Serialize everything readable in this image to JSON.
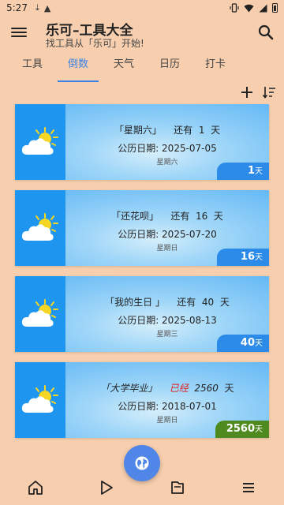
{
  "status_bar": {
    "time": "5:27"
  },
  "header": {
    "title": "乐可–工具大全",
    "subtitle": "找工具从「乐可」开始!"
  },
  "tabs": [
    {
      "label": "工具",
      "active": false
    },
    {
      "label": "倒数",
      "active": true
    },
    {
      "label": "天气",
      "active": false
    },
    {
      "label": "日历",
      "active": false
    },
    {
      "label": "打卡",
      "active": false
    }
  ],
  "cards": [
    {
      "name": "「星期六」",
      "status": "还有",
      "count": "1",
      "unit": "天",
      "date_line": "公历日期:  2025-07-05",
      "weekday": "星期六",
      "badge_num": "1",
      "badge_unit": "天",
      "passed": false
    },
    {
      "name": "「还花呗」",
      "status": "还有",
      "count": "16",
      "unit": "天",
      "date_line": "公历日期:  2025-07-20",
      "weekday": "星期日",
      "badge_num": "16",
      "badge_unit": "天",
      "passed": false
    },
    {
      "name": "「我的生日 」",
      "status": "还有",
      "count": "40",
      "unit": "天",
      "date_line": "公历日期:  2025-08-13",
      "weekday": "星期三",
      "badge_num": "40",
      "badge_unit": "天",
      "passed": false
    },
    {
      "name": "「大学毕业」",
      "status": "已经",
      "count": "2560",
      "unit": "天",
      "date_line": "公历日期:  2018-07-01",
      "weekday": "星期日",
      "badge_num": "2560",
      "badge_unit": "天",
      "passed": true
    }
  ],
  "icons": {
    "menu": "menu-icon",
    "search": "search-icon",
    "add": "add-icon",
    "sort": "sort-icon",
    "fab": "globe-icon",
    "home": "home-icon",
    "play": "play-icon",
    "folder": "folder-icon",
    "more": "list-icon",
    "weather": "partly-sunny-icon"
  },
  "colors": {
    "accent": "#3b82e6",
    "background": "#f7cfae",
    "card_blue": "#1e96f0",
    "passed_badge": "#4f8a20",
    "passed_text": "#e02020"
  }
}
